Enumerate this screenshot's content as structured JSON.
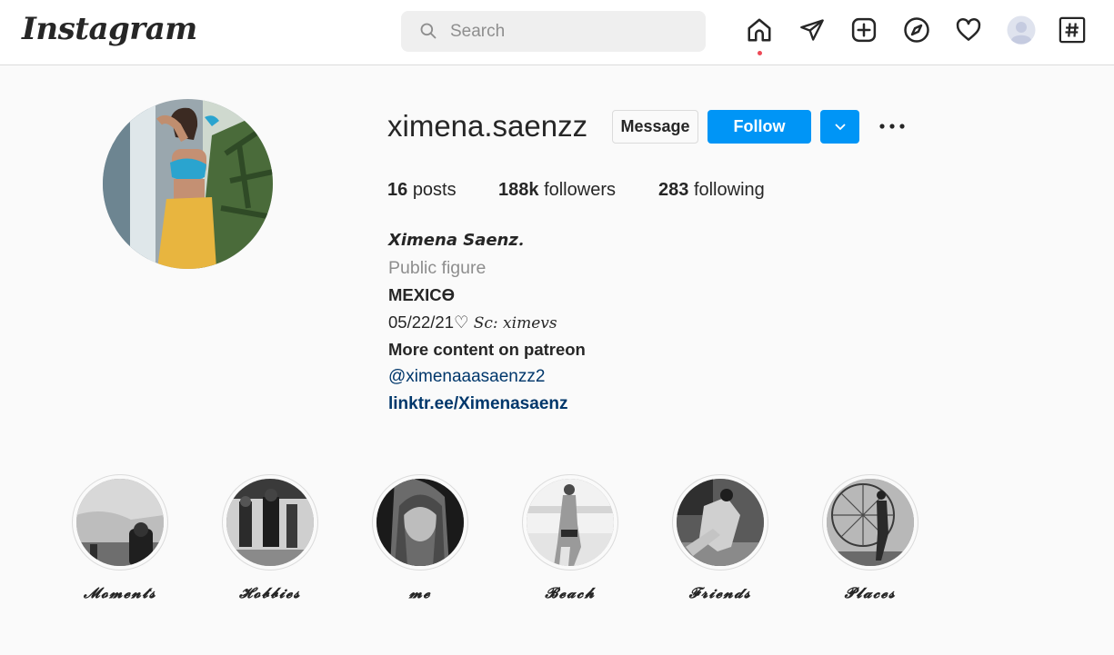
{
  "header": {
    "logo": "Instagram",
    "search_placeholder": "Search",
    "nav_icons": [
      "home-icon",
      "direct-icon",
      "new-post-icon",
      "explore-icon",
      "activity-icon",
      "profile-avatar",
      "hashtag-icon"
    ],
    "active_dot_color": "#ed4956"
  },
  "profile": {
    "username": "ximena.saenzz",
    "message_label": "Message",
    "follow_label": "Follow",
    "stats": {
      "posts_count": "16",
      "posts_label": "posts",
      "followers_count": "188k",
      "followers_label": "followers",
      "following_count": "283",
      "following_label": "following"
    },
    "bio": {
      "name": "𝙓𝙞𝙢𝙚𝙣𝙖 𝙎𝙖𝙚𝙣𝙯.",
      "category": "Public figure",
      "country": "MEXICϴ",
      "date_prefix": "05/22/21♡ ",
      "date_credit": "Sc: ximevs",
      "patreon": "More content on patreon",
      "mention": "@ximenaaasaenzz2",
      "link": "linktr.ee/Ximenasaenz"
    }
  },
  "highlights": [
    {
      "label": "𝓜𝓸𝓶𝓮𝓷𝓽𝓼"
    },
    {
      "label": "𝓗𝓸𝓫𝓫𝓲𝓮𝓼"
    },
    {
      "label": "𝓶𝓮"
    },
    {
      "label": "𝓑𝓮𝓪𝓬𝓱"
    },
    {
      "label": "𝓕𝓻𝓲𝓮𝓷𝓭𝓼"
    },
    {
      "label": "𝓟𝓵𝓪𝓬𝓮𝓼"
    }
  ],
  "colors": {
    "accent": "#0095f6",
    "link": "#00376b",
    "text": "#262626",
    "secondary": "#8e8e8e"
  }
}
